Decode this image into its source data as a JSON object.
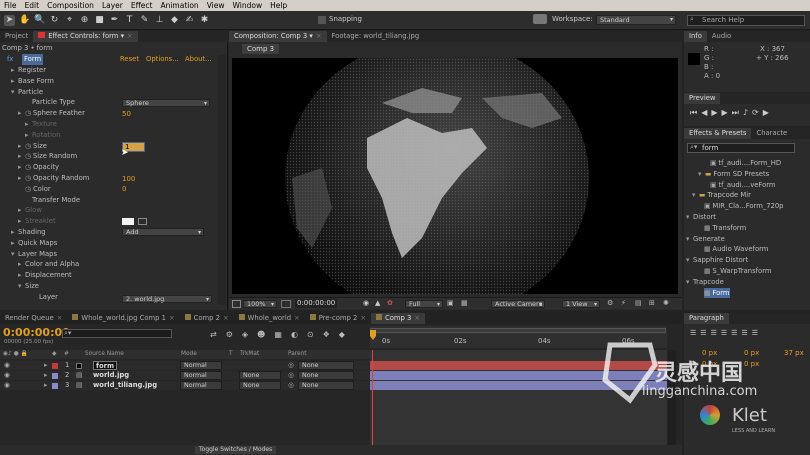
{
  "menu": [
    "File",
    "Edit",
    "Composition",
    "Layer",
    "Effect",
    "Animation",
    "View",
    "Window",
    "Help"
  ],
  "toolbar": {
    "snapping": "Snapping",
    "workspace_label": "Workspace:",
    "workspace_value": "Standard",
    "search_placeholder": "Search Help"
  },
  "left_panel": {
    "tabs": [
      "Project",
      "Effect Controls: form"
    ],
    "breadcrumb": "Comp 3 • form",
    "fx_label": "fx",
    "effect_name": "Form",
    "reset": "Reset",
    "options": "Options...",
    "about": "About...",
    "rows": [
      {
        "label": "Register",
        "indent": 1,
        "arrow": "▸"
      },
      {
        "label": "Base Form",
        "indent": 1,
        "arrow": "▸"
      },
      {
        "label": "Particle",
        "indent": 1,
        "arrow": "▾"
      },
      {
        "label": "Particle Type",
        "indent": 3,
        "arrow": ""
      },
      {
        "label": "Sphere Feather",
        "indent": 2,
        "arrow": "▸",
        "stopwatch": true
      },
      {
        "label": "Texture",
        "indent": 3,
        "arrow": "▸",
        "dim": true
      },
      {
        "label": "Rotation",
        "indent": 3,
        "arrow": "▸",
        "dim": true
      },
      {
        "label": "Size",
        "indent": 2,
        "arrow": "▸",
        "stopwatch": true
      },
      {
        "label": "Size Random",
        "indent": 2,
        "arrow": "▸",
        "stopwatch": true
      },
      {
        "label": "Opacity",
        "indent": 2,
        "arrow": "▸",
        "stopwatch": true
      },
      {
        "label": "Opacity Random",
        "indent": 2,
        "arrow": "▸",
        "stopwatch": true
      },
      {
        "label": "Color",
        "indent": 2,
        "arrow": "",
        "stopwatch": true
      },
      {
        "label": "Transfer Mode",
        "indent": 3,
        "arrow": ""
      },
      {
        "label": "Glow",
        "indent": 2,
        "arrow": "▸",
        "dim": true
      },
      {
        "label": "Streaklet",
        "indent": 2,
        "arrow": "▸",
        "dim": true
      },
      {
        "label": "Shading",
        "indent": 1,
        "arrow": "▸"
      },
      {
        "label": "Quick Maps",
        "indent": 1,
        "arrow": "▸"
      },
      {
        "label": "Layer Maps",
        "indent": 1,
        "arrow": "▾"
      },
      {
        "label": "Color and Alpha",
        "indent": 2,
        "arrow": "▸"
      },
      {
        "label": "Displacement",
        "indent": 2,
        "arrow": "▸"
      },
      {
        "label": "Size",
        "indent": 2,
        "arrow": "▾"
      },
      {
        "label": "Layer",
        "indent": 4,
        "arrow": ""
      }
    ],
    "particle_type": "Sphere",
    "sphere_feather": "50",
    "size": "1",
    "size_random": "0",
    "opacity": "100",
    "opacity_random": "0",
    "transfer_mode": "Add",
    "layer_value": "2. world.jpg"
  },
  "viewer": {
    "tabs": [
      "Composition: Comp 3",
      "Footage: world_tiliang.jpg"
    ],
    "subtab": "Comp 3",
    "zoom": "100%",
    "timecode": "0:00:00:00",
    "resolution": "Full",
    "camera": "Active Camera",
    "views": "1 View"
  },
  "info": {
    "tabs": [
      "Info",
      "Audio"
    ],
    "r": "R :",
    "g": "G :",
    "b": "B :",
    "a": "A : 0",
    "x": "X : 367",
    "y": "+ Y : 266"
  },
  "preview": {
    "tab": "Preview"
  },
  "effects": {
    "tabs": [
      "Effects & Presets",
      "Characte"
    ],
    "search": "form",
    "items": [
      {
        "label": "tf_audi....Form_HD",
        "indent": 4,
        "icon": "preset"
      },
      {
        "label": "Form SD Presets",
        "indent": 2,
        "icon": "folder",
        "arrow": "▾"
      },
      {
        "label": "tf_audi....veForm",
        "indent": 4,
        "icon": "preset"
      },
      {
        "label": "Trapcode Mir",
        "indent": 1,
        "icon": "folder",
        "arrow": "▾"
      },
      {
        "label": "MIR_Cla...Form_720p",
        "indent": 3,
        "icon": "preset"
      },
      {
        "label": "Distort",
        "indent": 0,
        "icon": "",
        "arrow": "▾"
      },
      {
        "label": "Transform",
        "indent": 3,
        "icon": "fx"
      },
      {
        "label": "Generate",
        "indent": 0,
        "icon": "",
        "arrow": "▾"
      },
      {
        "label": "Audio Waveform",
        "indent": 3,
        "icon": "fx"
      },
      {
        "label": "Sapphire Distort",
        "indent": 0,
        "icon": "",
        "arrow": "▾"
      },
      {
        "label": "S_WarpTransform",
        "indent": 3,
        "icon": "fx"
      },
      {
        "label": "Trapcode",
        "indent": 0,
        "icon": "",
        "arrow": "▾"
      },
      {
        "label": "Form",
        "indent": 3,
        "icon": "fx",
        "selected": true
      }
    ]
  },
  "paragraph": {
    "tab": "Paragraph",
    "v1": "0 px",
    "v2": "0 px",
    "v3": "0 px",
    "v4": "0 px",
    "v5": "37 px"
  },
  "timeline": {
    "tabs": [
      "Render Queue",
      "Whole_world.jpg Comp 1",
      "Comp 2",
      "Whole_world",
      "Pre-comp 2",
      "Comp 3"
    ],
    "timecode": "0:00:00:00",
    "fps": "00000 (25.00 fps)",
    "columns": {
      "source": "Source Name",
      "mode": "Mode",
      "t": "T",
      "trkmat": "TrkMat",
      "parent": "Parent"
    },
    "ruler": [
      "0s",
      "02s",
      "04s",
      "06s"
    ],
    "rows": [
      {
        "num": "1",
        "name": "form",
        "mode": "Normal",
        "trkmat": "",
        "parent": "None",
        "color": "#c23a3a"
      },
      {
        "num": "2",
        "name": "world.jpg",
        "mode": "Normal",
        "trkmat": "None",
        "parent": "None",
        "color": "#8a8ac8"
      },
      {
        "num": "3",
        "name": "world_tiliang.jpg",
        "mode": "Normal",
        "trkmat": "None",
        "parent": "None",
        "color": "#8a8ac8"
      }
    ],
    "toggle": "Toggle Switches / Modes"
  },
  "watermark": {
    "cn": "灵感中国",
    "url": "lingganchina.com",
    "klet": "Klet",
    "sub": "LESS AND LEARN"
  },
  "colors": {
    "accent": "#e0a020",
    "layer_red": "#c23a3a",
    "layer_blue": "#8a8ac8",
    "bar_red": "#b24a4a",
    "bar_blue": "#7d7fb8"
  }
}
